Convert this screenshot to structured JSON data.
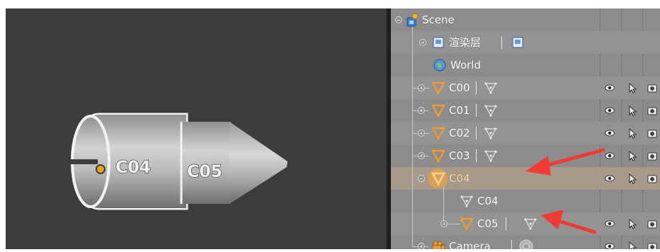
{
  "viewport": {
    "labels": {
      "c04": "C04",
      "c05": "C05"
    },
    "colors": {
      "background": "#3a3d3a",
      "object": "#b4b6b4",
      "outline": "#f2f2f2",
      "origin": "#f0a020"
    }
  },
  "outliner": {
    "root": {
      "label": "Scene",
      "icon": "scene-icon"
    },
    "render_layers": {
      "label": "渲染层",
      "icon": "render-layer-icon"
    },
    "world": {
      "label": "World",
      "icon": "world-icon"
    },
    "objects": [
      {
        "label": "C00",
        "icon": "mesh-object-icon",
        "data_icon": "mesh-data-icon"
      },
      {
        "label": "C01",
        "icon": "mesh-object-icon",
        "data_icon": "mesh-data-icon"
      },
      {
        "label": "C02",
        "icon": "mesh-object-icon",
        "data_icon": "mesh-data-icon"
      },
      {
        "label": "C03",
        "icon": "mesh-object-icon",
        "data_icon": "mesh-data-icon"
      },
      {
        "label": "C04",
        "icon": "mesh-object-icon",
        "selected": true,
        "expanded": true,
        "children": [
          {
            "label": "C04",
            "icon": "mesh-data-icon"
          },
          {
            "label": "C05",
            "icon": "mesh-object-icon",
            "data_icon": "mesh-data-icon"
          }
        ]
      }
    ],
    "camera": {
      "label": "Camera",
      "icon": "camera-object-icon",
      "data_icon": "camera-data-icon"
    },
    "column_icons": [
      "eye-icon",
      "cursor-arrow-icon",
      "render-camera-icon"
    ],
    "colors": {
      "panel": "#8c8c8c",
      "row_alt": "#939393",
      "selected_row": "#a89a8a",
      "object_icon": "#f29a2e"
    }
  },
  "annotations": {
    "arrow_color": "#ef3b33"
  }
}
